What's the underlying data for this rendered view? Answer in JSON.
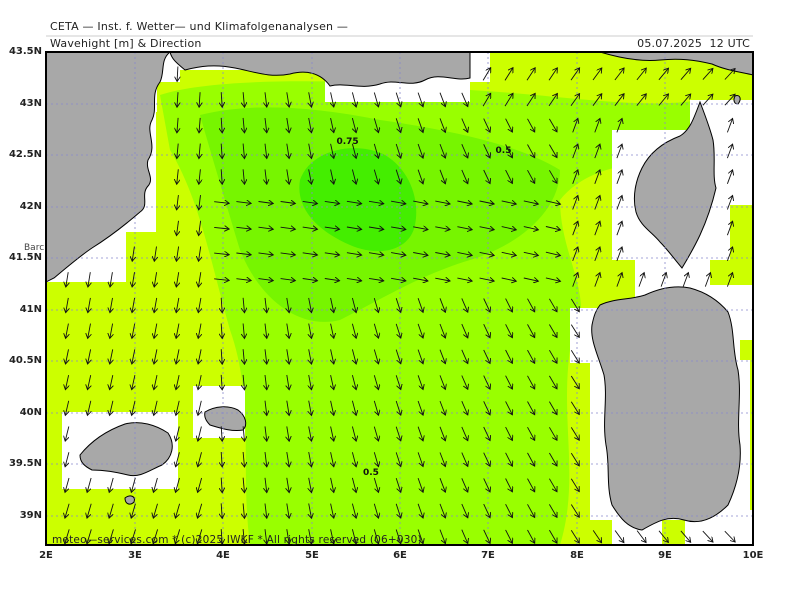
{
  "header": {
    "organisation": "CETA — Inst. f. Wetter— und Klimafolgenanalysen —",
    "parameter": "Wavehight [m] & Direction",
    "valid_time": "05.07.2025  12 UTC"
  },
  "footer": "meteo—services.com * (c)2025 IWKF * All rights reserved (06+030)",
  "axes": {
    "lat_labels": [
      "43.5N",
      "43N",
      "42.5N",
      "42N",
      "41.5N",
      "41N",
      "40.5N",
      "40N",
      "39.5N",
      "39N"
    ],
    "lon_labels": [
      "2E",
      "3E",
      "4E",
      "5E",
      "6E",
      "7E",
      "8E",
      "9E",
      "10E"
    ]
  },
  "contours": {
    "labels": [
      {
        "text": "0.75",
        "lon": 5.4,
        "lat": 42.62
      },
      {
        "text": "0.5",
        "lon": 7.2,
        "lat": 42.53
      },
      {
        "text": "0.5",
        "lon": 5.7,
        "lat": 39.41
      }
    ]
  },
  "place_labels": {
    "barcelona_partial": "Barc"
  },
  "colors": {
    "wave_low": "#ccff00",
    "wave_mid": "#99ff00",
    "wave_high": "#44ee00",
    "land": "#a8a8a8",
    "grid": "#8888cc"
  }
}
